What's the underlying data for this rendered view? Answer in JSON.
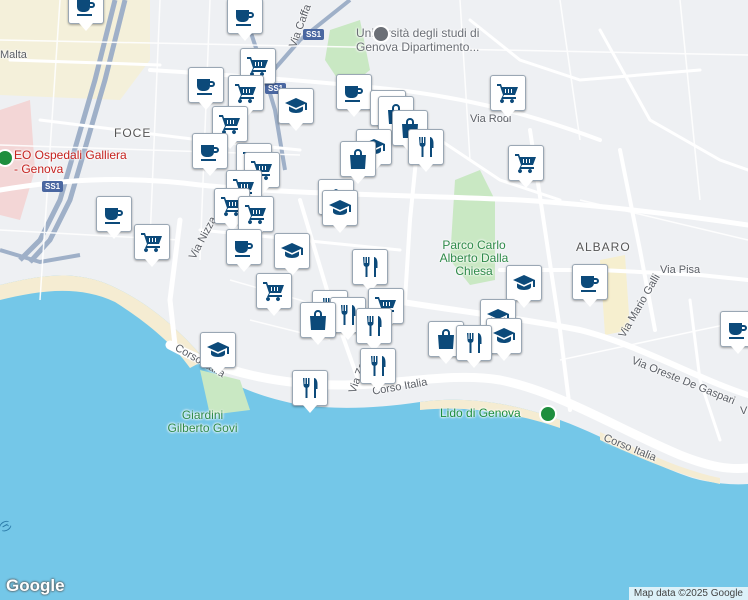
{
  "map": {
    "colors": {
      "sea": "#74c7e8",
      "land": "#eef0f3",
      "park": "#c9e8c3",
      "road": "#ffffff",
      "highway": "#9fb0c8",
      "beach": "#f5ecd2",
      "pin_icon": "#0c4a7a"
    },
    "labels": {
      "malta": "Malta",
      "foce": "FOCE",
      "hospital": "EO Ospedali Galliera - Genova",
      "university": "Università degli studi di Genova Dipartimento...",
      "via_rodi": "Via Rodi",
      "albaro": "ALBARO",
      "park": "Parco Carlo Alberto Dalla Chiesa",
      "via_pisa": "Via Pisa",
      "via_mario_galli": "Via Mario Galli",
      "via_oreste": "Via Oreste De Gaspari",
      "via_nizza": "Via Nizza",
      "via_caffa": "Via Caffa",
      "corso_italia_1": "Corso Italia",
      "corso_italia_2": "Corso Italia",
      "corso_italia_3": "Corso Italia",
      "via_za": "Via Za",
      "giardini": "Giardini Gilberto Govi",
      "lido": "Lido di Genova",
      "ss1_a": "SS1",
      "ss1_b": "SS1",
      "ss1_c": "SS1",
      "sea_label": "(r)",
      "via_v": "V"
    },
    "pins_legend": [
      "cafe",
      "shopping-cart",
      "school",
      "shopping-bag",
      "restaurant"
    ]
  },
  "footer": {
    "logo": "Google",
    "attribution": "Map data ©2025 Google"
  }
}
